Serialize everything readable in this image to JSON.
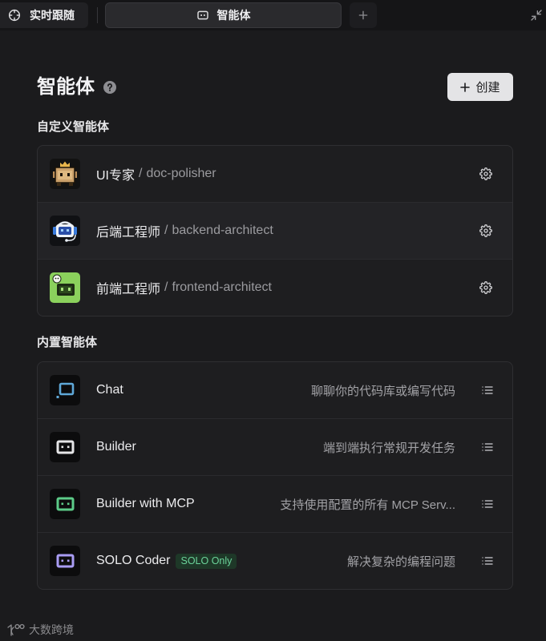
{
  "tab_bar": {
    "follow_tab": {
      "label": "实时跟随",
      "icon": "crosshair-icon"
    },
    "agents_tab": {
      "label": "智能体",
      "icon": "agent-icon",
      "active": true
    },
    "new_tab_icon": "plus-icon",
    "collapse_icon": "minimize-icon"
  },
  "header": {
    "title": "智能体",
    "help_icon": "help-icon",
    "create_button": {
      "icon": "plus-icon",
      "label": "创建"
    }
  },
  "custom_agents": {
    "title": "自定义智能体",
    "separator": "/",
    "items": [
      {
        "name": "UI专家",
        "slug": "doc-polisher",
        "avatar": "crown-robot-avatar",
        "action_icon": "gear-icon"
      },
      {
        "name": "后端工程师",
        "slug": "backend-architect",
        "avatar": "headset-robot-avatar",
        "action_icon": "gear-icon"
      },
      {
        "name": "前端工程师",
        "slug": "frontend-architect",
        "avatar": "green-robot-avatar",
        "action_icon": "gear-icon"
      }
    ]
  },
  "builtin_agents": {
    "title": "内置智能体",
    "items": [
      {
        "name": "Chat",
        "description": "聊聊你的代码库或编写代码",
        "icon": "chat-robot-icon",
        "icon_color": "#5fa8d8",
        "action_icon": "list-icon"
      },
      {
        "name": "Builder",
        "description": "端到端执行常规开发任务",
        "icon": "builder-robot-icon",
        "icon_color": "#e6e6e8",
        "action_icon": "list-icon"
      },
      {
        "name": "Builder with MCP",
        "description": "支持使用配置的所有 MCP Serv...",
        "icon": "mcp-robot-icon",
        "icon_color": "#5ccb88",
        "action_icon": "list-icon"
      },
      {
        "name": "SOLO Coder",
        "badge": "SOLO Only",
        "description": "解决复杂的编程问题",
        "icon": "solo-robot-icon",
        "icon_color": "#a99cf3",
        "action_icon": "list-icon"
      }
    ]
  },
  "watermark": {
    "text": "大数跨境",
    "logo": "brand-logo-icon"
  },
  "colors": {
    "background": "#1b1b1d",
    "badge_text": "#6bd39a",
    "badge_bg": "#1e3828",
    "create_button_bg": "#e4e4e6"
  }
}
